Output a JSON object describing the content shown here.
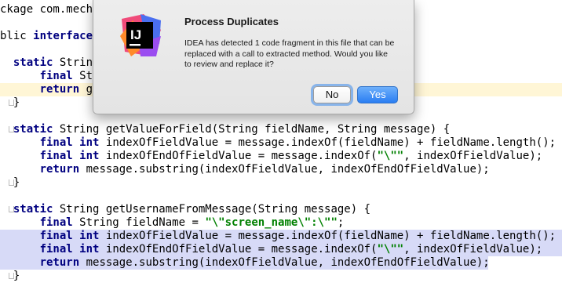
{
  "editor": {
    "lines": [
      {
        "text": "ckage com.mechanitis.demo.sense.twitter;",
        "highlight": false
      },
      {
        "text": "",
        "highlight": false
      },
      {
        "text": "blic interface Pa",
        "highlight": false
      },
      {
        "text": "",
        "highlight": false
      },
      {
        "text": "  static String getUsername",
        "highlight": false
      },
      {
        "text": "      final String fieldName = \"\\\"text\\\":\\\"\";",
        "highlight": false
      },
      {
        "text": "      return getValueForField(fieldName, message);",
        "highlight": false
      },
      {
        "text": "  }",
        "highlight": false
      },
      {
        "text": "",
        "highlight": false
      },
      {
        "text": "  static String getValueForField(String fieldName, String message) {",
        "highlight": false
      },
      {
        "text": "      final int indexOfFieldValue = message.indexOf(fieldName) + fieldName.length();",
        "highlight": false
      },
      {
        "text": "      final int indexOfEndOfFieldValue = message.indexOf(\"\\\"\", indexOfFieldValue);",
        "highlight": false
      },
      {
        "text": "      return message.substring(indexOfFieldValue, indexOfEndOfFieldValue);",
        "highlight": false
      },
      {
        "text": "  }",
        "highlight": false
      },
      {
        "text": "",
        "highlight": false
      },
      {
        "text": "  static String getUsernameFromMessage(String message) {",
        "highlight": false
      },
      {
        "text": "      final String fieldName = \"\\\"screen_name\\\":\\\"\";",
        "highlight": false
      },
      {
        "text": "      final int indexOfFieldValue = message.indexOf(fieldName) + fieldName.length();",
        "highlight": true
      },
      {
        "text": "      final int indexOfEndOfFieldValue = message.indexOf(\"\\\"\", indexOfFieldValue);",
        "highlight": true
      },
      {
        "text": "      return message.substring(indexOfFieldValue, indexOfEndOfFieldValue);",
        "highlight": true
      },
      {
        "text": "  }",
        "highlight": false
      }
    ]
  },
  "dialog": {
    "title": "Process Duplicates",
    "message": "IDEA has detected 1 code fragment in this file that can be replaced with a call to extracted method. Would you like to review and replace it?",
    "logo_text": "IJ",
    "no_label": "No",
    "yes_label": "Yes",
    "colors": {
      "accent": "#2a7df2",
      "selection": "#d7daf7"
    }
  }
}
